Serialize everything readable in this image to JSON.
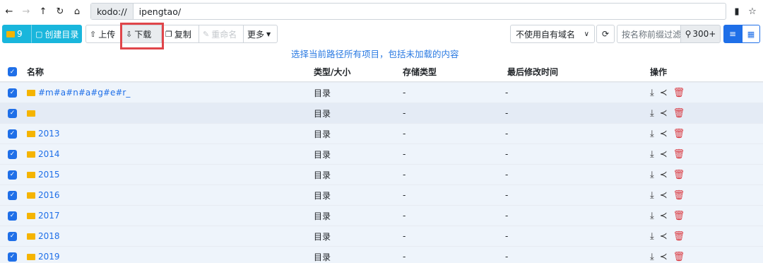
{
  "addressbar": {
    "back_icon": "←",
    "forward_icon": "→",
    "up_icon": "↑",
    "refresh_icon": "↻",
    "home_icon": "⌂",
    "prefix": "kodo://",
    "path": "ipengtao/",
    "bookmark_icon": "▮",
    "star_icon": "☆"
  },
  "toolbar": {
    "folder_count": "9",
    "create_dir_label": "创建目录",
    "upload_label": "上传",
    "download_label": "下载",
    "copy_label": "复制",
    "rename_label": "重命名",
    "more_label": "更多",
    "domain_select": "不使用自有域名",
    "filter_placeholder": "按名称前缀过滤",
    "result_count": "300+",
    "hint": "选择当前路径所有项目，包括未加载的内容"
  },
  "table": {
    "headers": [
      "名称",
      "类型/大小",
      "存储类型",
      "最后修改时间",
      "操作"
    ],
    "rows": [
      {
        "name": "#m#a#n#a#g#e#r_",
        "type": "目录",
        "storage": "-",
        "modified": "-"
      },
      {
        "name": "",
        "type": "目录",
        "storage": "-",
        "modified": "-"
      },
      {
        "name": "2013",
        "type": "目录",
        "storage": "-",
        "modified": "-"
      },
      {
        "name": "2014",
        "type": "目录",
        "storage": "-",
        "modified": "-"
      },
      {
        "name": "2015",
        "type": "目录",
        "storage": "-",
        "modified": "-"
      },
      {
        "name": "2016",
        "type": "目录",
        "storage": "-",
        "modified": "-"
      },
      {
        "name": "2017",
        "type": "目录",
        "storage": "-",
        "modified": "-"
      },
      {
        "name": "2018",
        "type": "目录",
        "storage": "-",
        "modified": "-"
      },
      {
        "name": "2019",
        "type": "目录",
        "storage": "-",
        "modified": "-"
      }
    ]
  },
  "colors": {
    "accent": "#1f6fe8",
    "primary_button": "#19b6dc",
    "folder": "#f5b400",
    "highlight": "#e0454a",
    "delete": "#d9363e"
  }
}
